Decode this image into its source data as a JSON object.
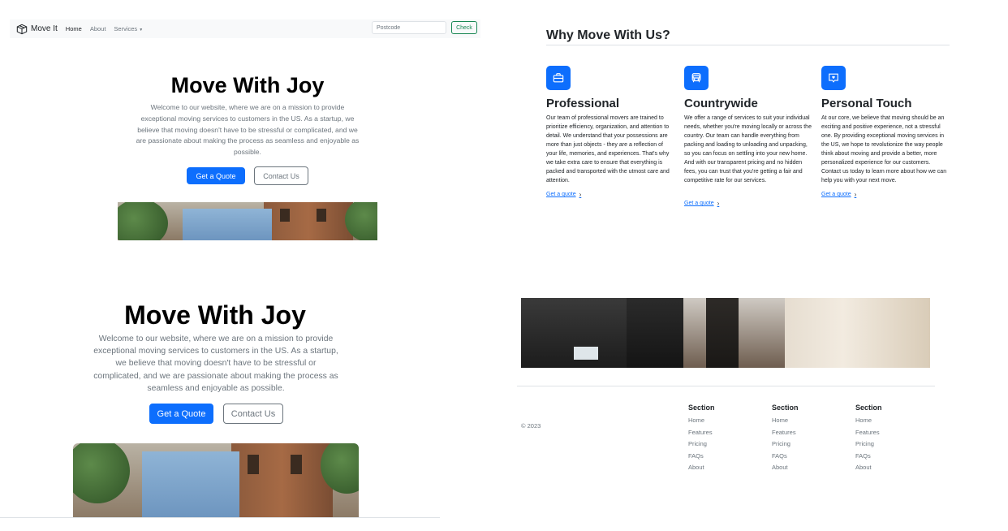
{
  "navbar": {
    "brand": "Move It",
    "links": [
      "Home",
      "About",
      "Services"
    ],
    "postcode_placeholder": "Postcode",
    "check_label": "Check"
  },
  "hero": {
    "title": "Move With Joy",
    "lead": "Welcome to our website, where we are on a mission to provide exceptional moving services to customers in the US. As a startup, we believe that moving doesn't have to be stressful or complicated, and we are passionate about making the process as seamless and enjoyable as possible.",
    "primary_label": "Get a Quote",
    "secondary_label": "Contact Us"
  },
  "features": {
    "heading": "Why Move With Us?",
    "items": [
      {
        "icon": "briefcase-icon",
        "title": "Professional",
        "text": "Our team of professional movers are trained to prioritize efficiency, organization, and attention to detail. We understand that your possessions are more than just objects - they are a reflection of your life, memories, and experiences. That's why we take extra care to ensure that everything is packed and transported with the utmost care and attention.",
        "link": "Get a quote"
      },
      {
        "icon": "truck-front-icon",
        "title": "Countrywide",
        "text": "We offer a range of services to suit your individual needs, whether you're moving locally or across the country. Our team can handle everything from packing and loading to unloading and unpacking, so you can focus on settling into your new home. And with our transparent pricing and no hidden fees, you can trust that you're getting a fair and competitive rate for our services.",
        "link": "Get a quote"
      },
      {
        "icon": "chat-heart-icon",
        "title": "Personal Touch",
        "text": "At our core, we believe that moving should be an exciting and positive experience, not a stressful one. By providing exceptional moving services in the US, we hope to revolutionize the way people think about moving and provide a better, more personalized experience for our customers. Contact us today to learn more about how we can help you with your next move.",
        "link": "Get a quote"
      }
    ]
  },
  "footer": {
    "copyright": "© 2023",
    "columns": [
      {
        "heading": "Section",
        "links": [
          "Home",
          "Features",
          "Pricing",
          "FAQs",
          "About"
        ]
      },
      {
        "heading": "Section",
        "links": [
          "Home",
          "Features",
          "Pricing",
          "FAQs",
          "About"
        ]
      },
      {
        "heading": "Section",
        "links": [
          "Home",
          "Features",
          "Pricing",
          "FAQs",
          "About"
        ]
      }
    ]
  },
  "colors": {
    "primary": "#0d6efd",
    "success": "#198754",
    "muted": "#6c757d"
  }
}
